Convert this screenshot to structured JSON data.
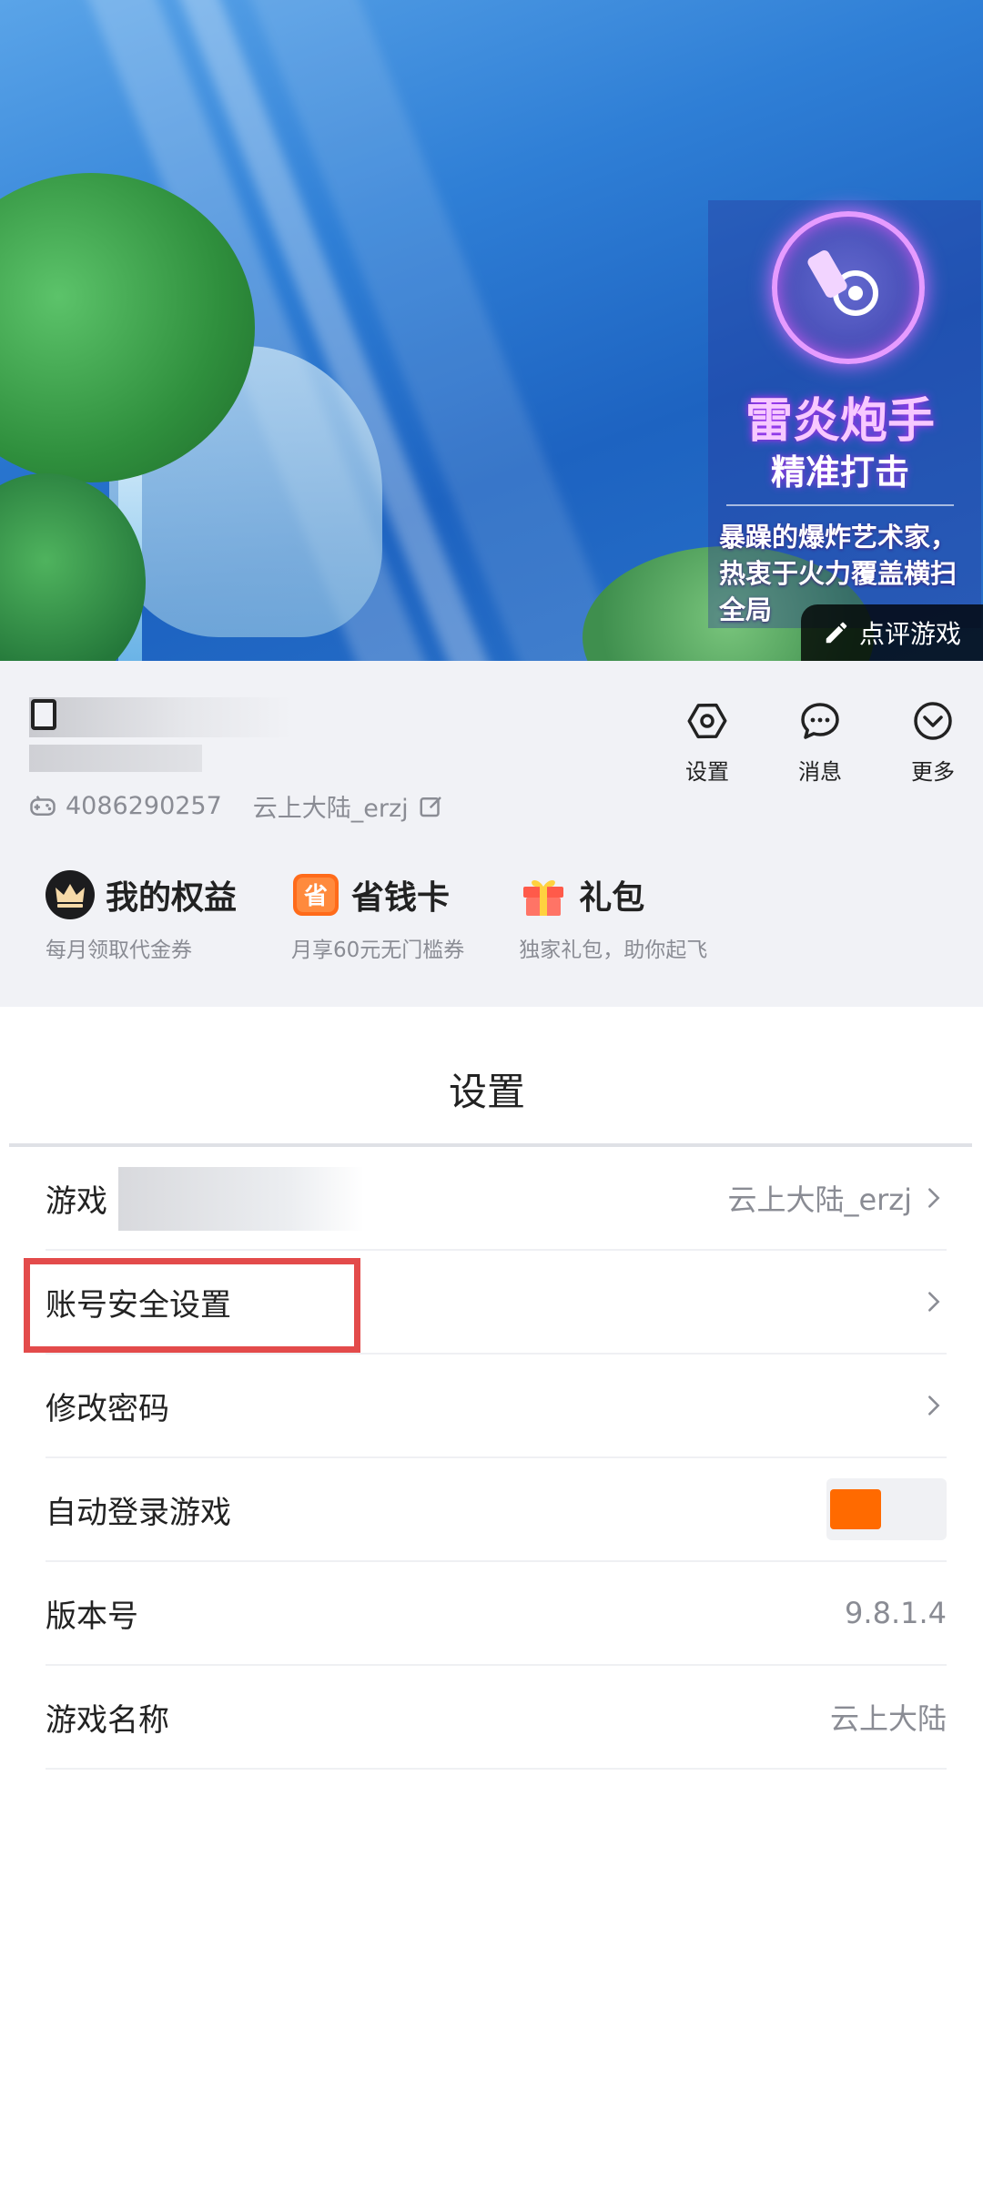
{
  "banner": {
    "promo_title": "雷炎炮手",
    "promo_subtitle": "精准打击",
    "promo_desc": "暴躁的爆炸艺术家，热衷于火力覆盖横扫全局",
    "review_button": "点评游戏"
  },
  "profile": {
    "uid": "4086290257",
    "game_account": "云上大陆_erzj",
    "actions": [
      {
        "label": "设置",
        "icon": "settings-hexagon-icon"
      },
      {
        "label": "消息",
        "icon": "message-bubble-icon"
      },
      {
        "label": "更多",
        "icon": "chevron-down-circle-icon"
      }
    ],
    "perks": [
      {
        "title": "我的权益",
        "subtitle": "每月领取代金券",
        "icon": "crown-icon"
      },
      {
        "title": "省钱卡",
        "subtitle": "月享60元无门槛券",
        "icon": "save-card-icon"
      },
      {
        "title": "礼包",
        "subtitle": "独家礼包，助你起飞",
        "icon": "gift-icon"
      }
    ]
  },
  "settings": {
    "title": "设置",
    "rows": [
      {
        "label": "游戏",
        "value": "云上大陆_erzj"
      },
      {
        "label": "账号安全设置",
        "value": ""
      },
      {
        "label": "修改密码",
        "value": ""
      },
      {
        "label": "自动登录游戏",
        "toggle_on": true
      },
      {
        "label": "版本号",
        "value": "9.8.1.4"
      },
      {
        "label": "游戏名称",
        "value": "云上大陆"
      }
    ]
  },
  "colors": {
    "accent": "#ff6a00",
    "highlight_box": "#e34b4b",
    "profile_bg": "#f1f2f6"
  }
}
